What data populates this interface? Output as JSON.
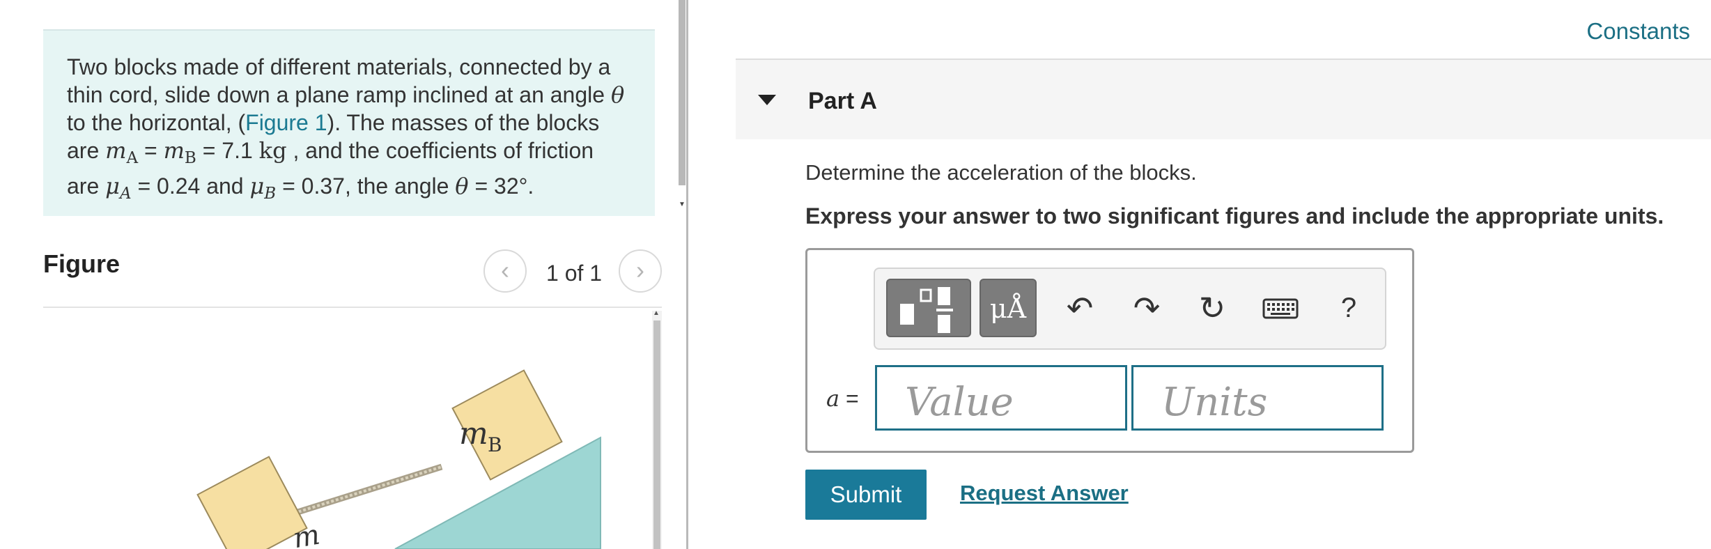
{
  "problem": {
    "text_1": "Two blocks made of different materials, connected by a thin cord, slide down a plane ramp inclined at an angle",
    "theta": "θ",
    "text_2": " to the horizontal, (",
    "figure_link": "Figure 1",
    "text_3": "). The masses of the blocks are ",
    "m": "m",
    "sub_A": "A",
    "sub_B": "B",
    "eq": " = ",
    "mass_value": " = 7.1  ",
    "mass_unit": "kg",
    "text_4": " , and the coefficients of friction are ",
    "mu": "μ",
    "mu_A_value": " = 0.24 and ",
    "mu_B_value": " = 0.37, the angle ",
    "angle_value": " = 32°."
  },
  "figure": {
    "title": "Figure",
    "prev_icon": "‹",
    "next_icon": "›",
    "counter": "1 of 1",
    "block_b_label": "m",
    "block_b_sub": "B",
    "block_a_label": "m"
  },
  "constants_link": "Constants",
  "part": {
    "title": "Part A",
    "question": "Determine the acceleration of the blocks.",
    "instruction": "Express your answer to two significant figures and include the appropriate units."
  },
  "toolbar": {
    "symbols_label": "μÅ",
    "undo_icon": "↶",
    "redo_icon": "↷",
    "reset_icon": "↻",
    "help_label": "?"
  },
  "answer": {
    "variable": "a",
    "equals": " =",
    "value_placeholder": "Value",
    "units_placeholder": "Units"
  },
  "buttons": {
    "submit": "Submit",
    "request_answer": "Request Answer"
  },
  "colors": {
    "accent": "#1a7a99",
    "link": "#1b6f84",
    "problem_bg": "#e6f5f4",
    "ramp": "#9dd6d3",
    "block": "#f6dfa2"
  }
}
